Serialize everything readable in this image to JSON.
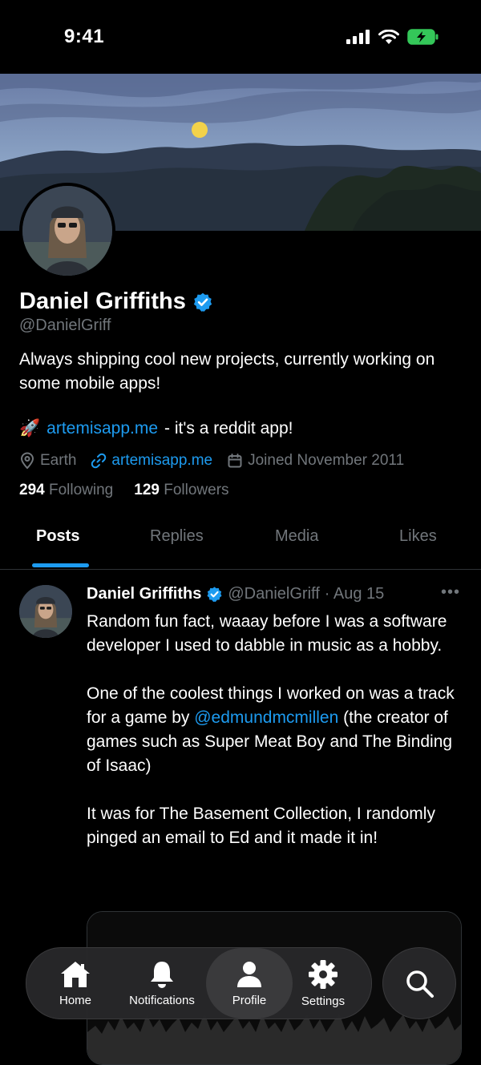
{
  "status_bar": {
    "time": "9:41"
  },
  "profile": {
    "display_name": "Daniel Griffiths",
    "handle": "@DanielGriff",
    "bio": "Always shipping cool new projects, currently working on some mobile apps!",
    "bio_link": {
      "emoji": "🚀",
      "link_text": "artemisapp.me",
      "suffix": "- it's a reddit app!"
    },
    "meta": {
      "location": "Earth",
      "website": "artemisapp.me",
      "joined": "Joined November 2011"
    },
    "following_count": "294",
    "following_label": "Following",
    "followers_count": "129",
    "followers_label": "Followers"
  },
  "tabs": [
    {
      "label": "Posts",
      "active": true
    },
    {
      "label": "Replies"
    },
    {
      "label": "Media"
    },
    {
      "label": "Likes"
    }
  ],
  "post": {
    "author": "Daniel Griffiths",
    "handle": "@DanielGriff",
    "date": "· Aug 15",
    "more": "•••",
    "para1": "Random fun fact, waaay before I was a software developer I used to dabble in music as a hobby.",
    "para2_before": "One of the coolest things I worked on was a track for a game by ",
    "para2_mention": "@edmundmcmillen",
    "para2_after": " (the creator of games such as Super Meat Boy and The Binding of Isaac)",
    "para3": "It was for The Basement Collection, I randomly pinged an email to Ed and it made it in!"
  },
  "tab_bar": {
    "items": [
      {
        "label": "Home",
        "icon": "home-icon"
      },
      {
        "label": "Notifications",
        "icon": "bell-icon"
      },
      {
        "label": "Profile",
        "icon": "person-icon",
        "active": true
      },
      {
        "label": "Settings",
        "icon": "gear-icon"
      }
    ],
    "search_icon": "search-icon"
  },
  "colors": {
    "accent": "#1d9bf0",
    "background": "#000000",
    "muted": "#71767b",
    "battery": "#34c759"
  }
}
